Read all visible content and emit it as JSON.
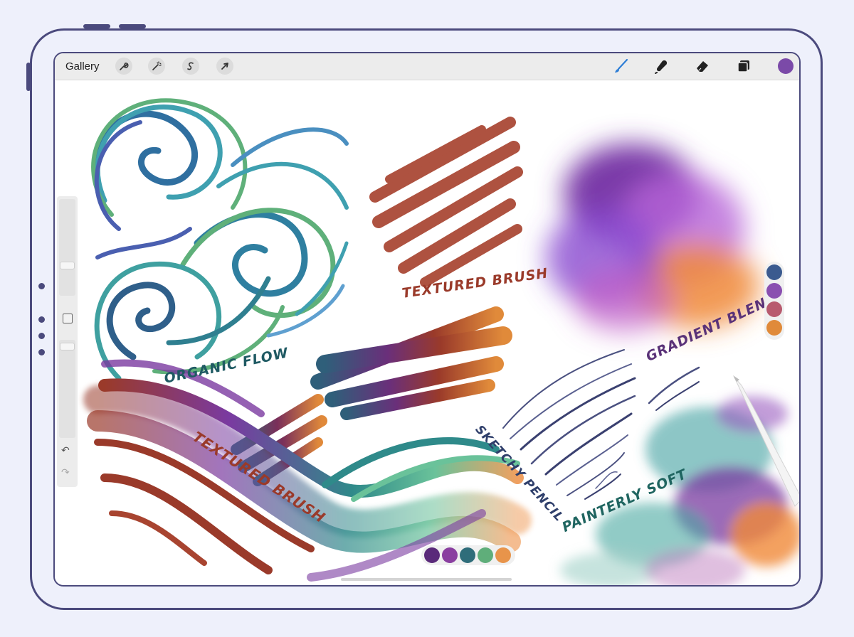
{
  "toolbar": {
    "gallery_label": "Gallery",
    "actions": [
      {
        "name": "actions-wrench-icon"
      },
      {
        "name": "adjustments-magic-wand-icon"
      },
      {
        "name": "selection-s-icon"
      },
      {
        "name": "transform-arrow-icon"
      }
    ],
    "tools": [
      {
        "name": "brush-icon",
        "color": "#2f7fd6",
        "active": true
      },
      {
        "name": "smudge-icon",
        "color": "#222222"
      },
      {
        "name": "eraser-icon",
        "color": "#222222"
      },
      {
        "name": "layers-icon",
        "color": "#222222"
      }
    ],
    "current_color": "#7b4aa8"
  },
  "sidebar": {
    "undo_icon": "↶",
    "redo_icon": "↷"
  },
  "canvas": {
    "labels": {
      "organic_flow": "ORGANIC FLOW",
      "textured_brush_top": "TEXTURED BRUSH",
      "gradient_blend": "GRADIENT BLEND",
      "textured_brush_bottom": "TEXTURED BRUSH",
      "sketchy_pencil": "SKETCHY PENCIL",
      "painterly_soft": "PAINTERLY SOFT"
    },
    "label_colors": {
      "organic_flow": "#1f5a63",
      "textured_brush": "#9a3a2a",
      "gradient_blend": "#5a3278",
      "sketchy_pencil": "#2f3f6b",
      "painterly_soft": "#1f6560"
    },
    "palette_vertical": [
      "#3b5b8f",
      "#8a4fb0",
      "#b85a6e",
      "#e08a3a"
    ],
    "palette_horizontal": [
      "#5a2a7a",
      "#8a3fa0",
      "#2f6d7a",
      "#5fae7a",
      "#e8944a"
    ]
  }
}
